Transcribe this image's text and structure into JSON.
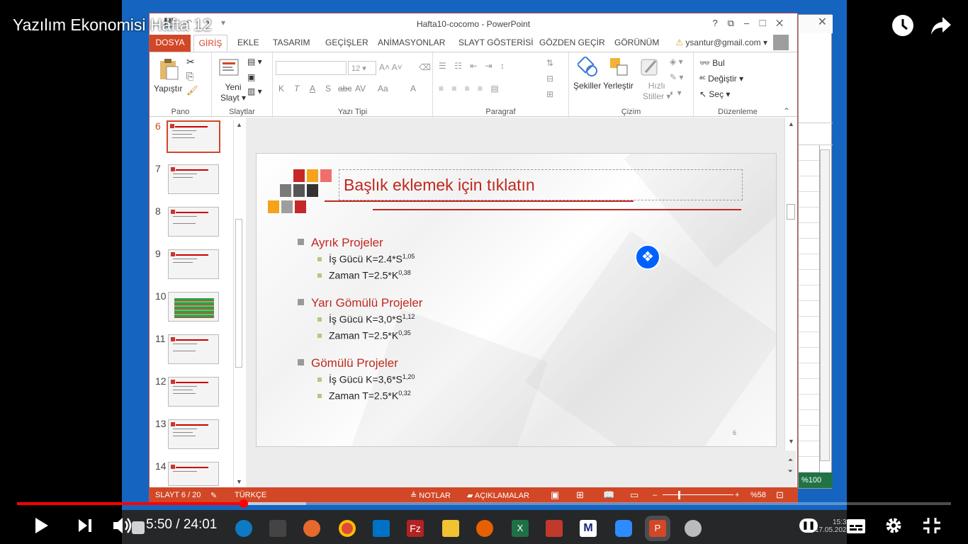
{
  "video": {
    "title": "Yazılım Ekonomisi Hafta 12",
    "time_current": "5:50",
    "time_total": "24:01",
    "time_separator": " / ",
    "progress": 0.243
  },
  "window": {
    "title": "Hafta10-cocomo - PowerPoint",
    "controls": [
      "?",
      "⧉",
      "–",
      "☐",
      "✕"
    ],
    "user_email": "ysantur@gmail.com"
  },
  "ribbon_tabs": [
    "DOSYA",
    "GİRİŞ",
    "EKLE",
    "TASARIM",
    "GEÇİŞLER",
    "ANİMASYONLAR",
    "SLAYT GÖSTERİSİ",
    "GÖZDEN GEÇİR",
    "GÖRÜNÜM"
  ],
  "ribbon": {
    "pano": {
      "label": "Pano",
      "paste": "Yapıştır"
    },
    "slaytlar": {
      "label": "Slaytlar",
      "new_slide_1": "Yeni",
      "new_slide_2": "Slayt"
    },
    "yazi_tipi": {
      "label": "Yazı Tipi",
      "font_size": "12",
      "bold": "K",
      "italic": "T",
      "underline": "A",
      "shadow": "S",
      "strike": "abc",
      "spacing": "AV",
      "case": "Aa",
      "color": "A"
    },
    "paragraf": {
      "label": "Paragraf"
    },
    "cizim": {
      "label": "Çizim",
      "shapes": "Şekiller",
      "arrange": "Yerleştir",
      "quick_1": "Hızlı",
      "quick_2": "Stiller"
    },
    "duzenleme": {
      "label": "Düzenleme",
      "find": "Bul",
      "replace": "Değiştir",
      "select": "Seç"
    }
  },
  "thumbnails": [
    {
      "num": "6",
      "selected": true
    },
    {
      "num": "7"
    },
    {
      "num": "8"
    },
    {
      "num": "9"
    },
    {
      "num": "10",
      "table": true
    },
    {
      "num": "11"
    },
    {
      "num": "12"
    },
    {
      "num": "13"
    },
    {
      "num": "14"
    }
  ],
  "slide": {
    "title": "Başlık eklemek için tıklatın",
    "page_number": "6",
    "sections": [
      {
        "heading": "Ayrık Projeler",
        "items": [
          {
            "text": "İş Gücü K=2.4*S",
            "sup": "1,05"
          },
          {
            "text": "Zaman  T=2.5*K",
            "sup": "0,38"
          }
        ]
      },
      {
        "heading": "Yarı Gömülü Projeler",
        "items": [
          {
            "text": "İş Gücü K=3,0*S",
            "sup": "1,12"
          },
          {
            "text": "Zaman  T=2.5*K",
            "sup": "0,35"
          }
        ]
      },
      {
        "heading": "Gömülü Projeler",
        "items": [
          {
            "text": "İş Gücü K=3,6*S",
            "sup": "1,20"
          },
          {
            "text": "Zaman  T=2.5*K",
            "sup": "0,32"
          }
        ]
      }
    ]
  },
  "statusbar": {
    "slide_info": "SLAYT 6 / 20",
    "language": "TÜRKÇE",
    "notes": "NOTLAR",
    "comments": "AÇIKLAMALAR",
    "zoom": "%58"
  },
  "background_window": {
    "zoom": "%100"
  },
  "taskbar": {
    "time": "15:33",
    "date": "17.05.2021"
  },
  "colors": {
    "accent": "#d24726",
    "title_red": "#c0281e",
    "youtube_red": "#ff0000"
  }
}
